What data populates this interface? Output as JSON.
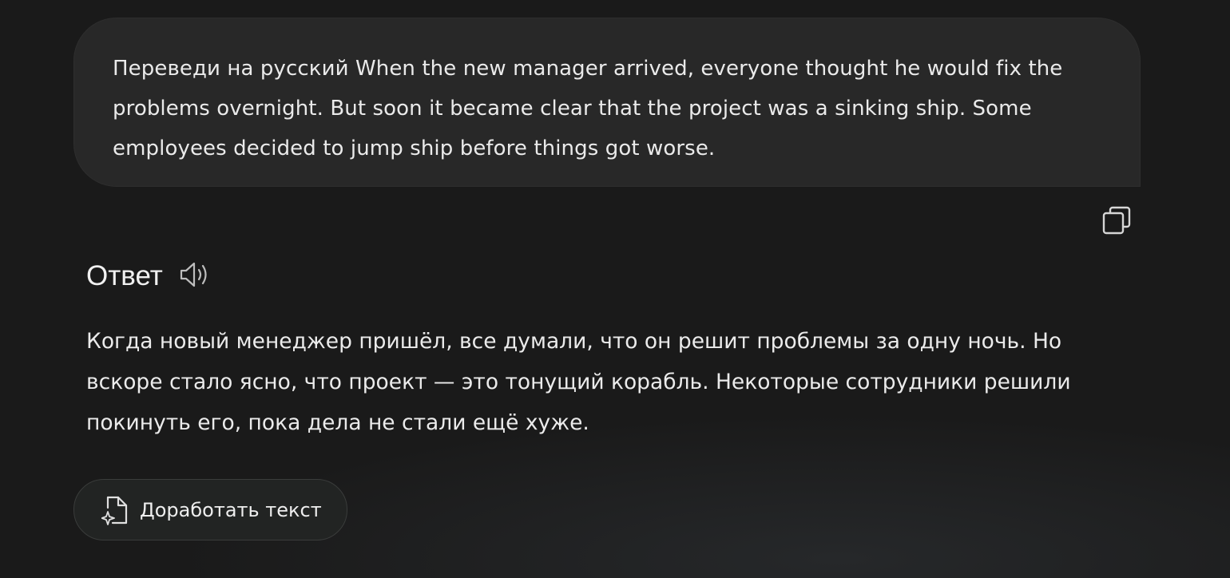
{
  "user_message": {
    "text": "Переведи на русский When the new manager arrived, everyone thought he would fix the problems overnight. But soon it became clear that the project was a sinking ship. Some employees decided to jump ship before things got worse."
  },
  "copy_button": {
    "icon": "copy-icon"
  },
  "answer": {
    "title": "Ответ",
    "speaker_icon": "speaker-icon",
    "text": "Когда новый менеджер пришёл, все думали, что он решит проблемы за одну ночь. Но вскоре стало ясно, что проект — это тонущий корабль. Некоторые сотрудники решили покинуть его, пока дела не стали ещё хуже."
  },
  "improve_button": {
    "label": "Доработать текст",
    "icon": "document-sparkle-icon"
  },
  "colors": {
    "background": "#1a1a1a",
    "bubble": "#282828",
    "text": "#ececec"
  }
}
